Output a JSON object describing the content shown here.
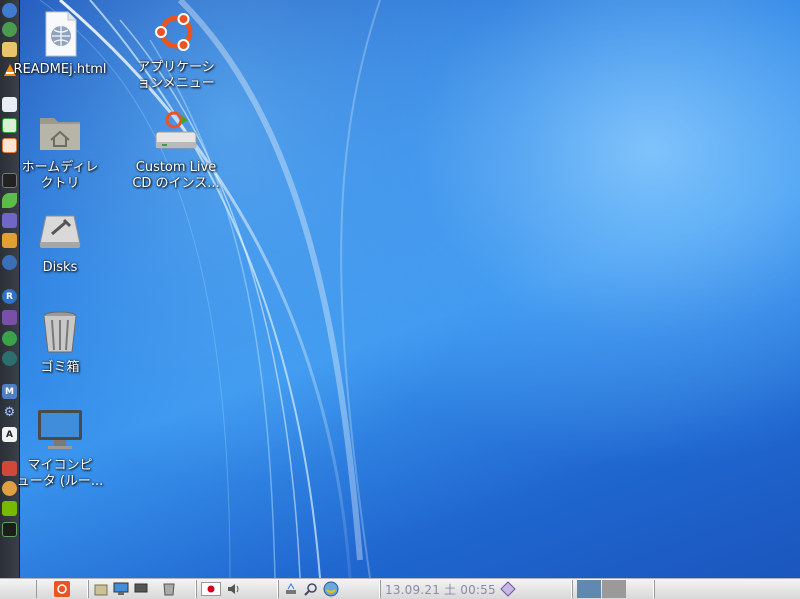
{
  "desktop_icons": [
    {
      "name": "readme-file",
      "label": "READMEj.html"
    },
    {
      "name": "applications-menu",
      "label": "アプリケーシ\nョンメニュー"
    },
    {
      "name": "home-folder",
      "label": "ホームディレ\nクトリ"
    },
    {
      "name": "custom-live-cd-installer",
      "label": "Custom Live\nCD のインス..."
    },
    {
      "name": "disks",
      "label": "Disks"
    },
    {
      "name": "trash",
      "label": "ゴミ箱"
    },
    {
      "name": "my-computer",
      "label": "マイコンピ\nュータ (ルー..."
    }
  ],
  "dock_items": [
    "globe-icon",
    "world-icon",
    "mail-icon",
    "vlc-icon",
    "document-icon",
    "spreadsheet-icon",
    "presentation-icon",
    "terminal-icon",
    "leaf-icon",
    "stack-icon",
    "shield-icon",
    "network-icon",
    "r-icon",
    "box-icon",
    "clover-icon",
    "swirl-icon",
    "m-icon",
    "gear-icon",
    "font-icon",
    "media-icon",
    "ubuntu-small-icon",
    "nvidia-icon",
    "monitor-icon"
  ],
  "panel": {
    "clock": "13.09.21 土 00:55",
    "colors": {
      "accent": "#e95420",
      "workspace_active": "#6088b0",
      "workspace_inactive": "#9a9a9a"
    }
  }
}
